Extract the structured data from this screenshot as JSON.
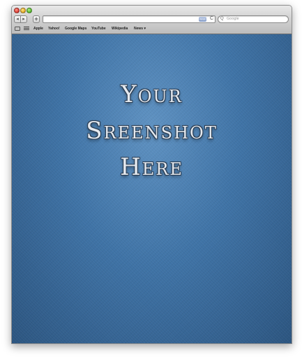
{
  "toolbar": {
    "back_icon": "◂",
    "forward_icon": "▸",
    "add_icon": "+",
    "address_value": "",
    "rss_label": "RSS",
    "reload_icon": "C",
    "search_placeholder": "Google",
    "search_icon": "Q"
  },
  "bookmarks": {
    "items": [
      {
        "label": "Apple"
      },
      {
        "label": "Yahoo!"
      },
      {
        "label": "Google Maps"
      },
      {
        "label": "YouTube"
      },
      {
        "label": "Wikipedia"
      },
      {
        "label": "News ▾"
      }
    ]
  },
  "content": {
    "line1": "Your",
    "line2": "Sreenshot",
    "line3": "Here"
  },
  "colors": {
    "background_blue": "#3f73a6",
    "headline_text": "#e4e9ef"
  }
}
